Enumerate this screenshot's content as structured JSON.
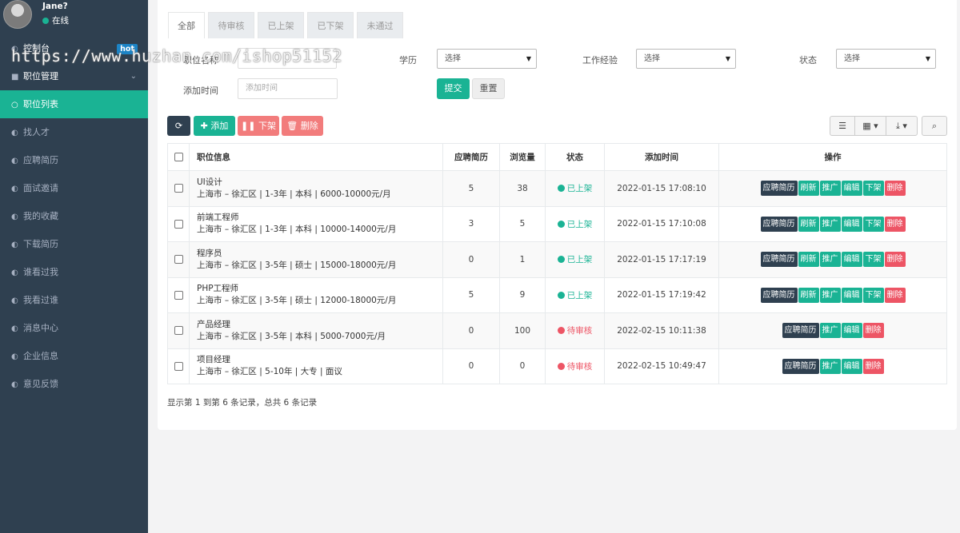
{
  "user": {
    "name": "Jane?",
    "status": "在线"
  },
  "sidebar": {
    "items": [
      {
        "label": "控制台",
        "icon": "dashboard-icon",
        "badge": "hot"
      },
      {
        "label": "职位管理",
        "icon": "briefcase-icon"
      },
      {
        "label": "职位列表",
        "icon": "circle-icon"
      },
      {
        "label": "找人才",
        "icon": "dashboard-icon"
      },
      {
        "label": "应聘简历",
        "icon": "dashboard-icon"
      },
      {
        "label": "面试邀请",
        "icon": "dashboard-icon"
      },
      {
        "label": "我的收藏",
        "icon": "dashboard-icon"
      },
      {
        "label": "下载简历",
        "icon": "dashboard-icon"
      },
      {
        "label": "谁看过我",
        "icon": "dashboard-icon"
      },
      {
        "label": "我看过谁",
        "icon": "dashboard-icon"
      },
      {
        "label": "消息中心",
        "icon": "dashboard-icon"
      },
      {
        "label": "企业信息",
        "icon": "dashboard-icon"
      },
      {
        "label": "意见反馈",
        "icon": "dashboard-icon"
      }
    ]
  },
  "watermark": "https://www.huzhan.com/ishop51152",
  "tabs": [
    "全部",
    "待审核",
    "已上架",
    "已下架",
    "未通过"
  ],
  "filters": {
    "name_label": "职位名称",
    "education_label": "学历",
    "education_value": "选择",
    "experience_label": "工作经验",
    "experience_value": "选择",
    "status_label": "状态",
    "status_value": "选择",
    "time_label": "添加时间",
    "time_placeholder": "添加时间",
    "submit": "提交",
    "reset": "重置"
  },
  "toolbar": {
    "add": "添加",
    "offline": "下架",
    "delete": "删除"
  },
  "table": {
    "headers": [
      "职位信息",
      "应聘简历",
      "浏览量",
      "状态",
      "添加时间",
      "操作"
    ],
    "rows": [
      {
        "title": "UI设计",
        "detail": "上海市 – 徐汇区 | 1-3年 | 本科 | 6000-10000元/月",
        "resumes": "5",
        "views": "38",
        "status": "已上架",
        "status_color": "#1ab394",
        "time": "2022-01-15 17:08:10",
        "actions": [
          "应聘简历",
          "刷新",
          "推广",
          "编辑",
          "下架",
          "删除"
        ]
      },
      {
        "title": "前端工程师",
        "detail": "上海市 – 徐汇区 | 1-3年 | 本科 | 10000-14000元/月",
        "resumes": "3",
        "views": "5",
        "status": "已上架",
        "status_color": "#1ab394",
        "time": "2022-01-15 17:10:08",
        "actions": [
          "应聘简历",
          "刷新",
          "推广",
          "编辑",
          "下架",
          "删除"
        ]
      },
      {
        "title": "程序员",
        "detail": "上海市 – 徐汇区 | 3-5年 | 硕士 | 15000-18000元/月",
        "resumes": "0",
        "views": "1",
        "status": "已上架",
        "status_color": "#1ab394",
        "time": "2022-01-15 17:17:19",
        "actions": [
          "应聘简历",
          "刷新",
          "推广",
          "编辑",
          "下架",
          "删除"
        ]
      },
      {
        "title": "PHP工程师",
        "detail": "上海市 – 徐汇区 | 3-5年 | 硕士 | 12000-18000元/月",
        "resumes": "5",
        "views": "9",
        "status": "已上架",
        "status_color": "#1ab394",
        "time": "2022-01-15 17:19:42",
        "actions": [
          "应聘简历",
          "刷新",
          "推广",
          "编辑",
          "下架",
          "删除"
        ]
      },
      {
        "title": "产品经理",
        "detail": "上海市 – 徐汇区 | 3-5年 | 本科 | 5000-7000元/月",
        "resumes": "0",
        "views": "100",
        "status": "待审核",
        "status_color": "#ed5565",
        "time": "2022-02-15 10:11:38",
        "actions": [
          "应聘简历",
          "推广",
          "编辑",
          "删除"
        ]
      },
      {
        "title": "项目经理",
        "detail": "上海市 – 徐汇区 | 5-10年 | 大专 | 面议",
        "resumes": "0",
        "views": "0",
        "status": "待审核",
        "status_color": "#ed5565",
        "time": "2022-02-15 10:49:47",
        "actions": [
          "应聘简历",
          "推广",
          "编辑",
          "删除"
        ]
      }
    ]
  },
  "pagination": {
    "info": "显示第 1 到第 6 条记录，总共 6 条记录"
  }
}
